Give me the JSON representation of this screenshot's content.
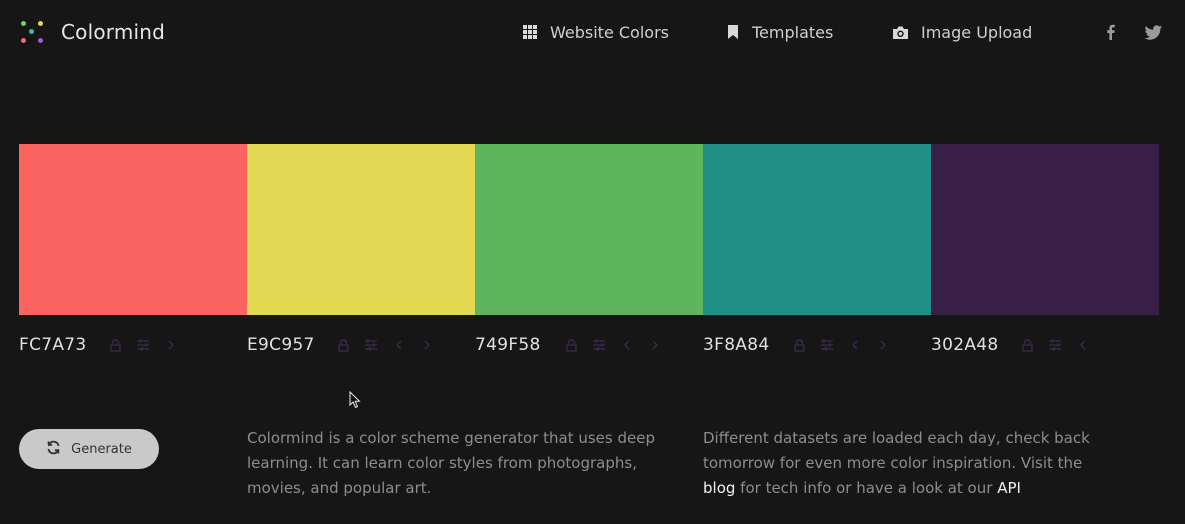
{
  "header": {
    "brand": "Colormind",
    "nav": [
      {
        "label": "Website Colors",
        "icon": "grid-icon"
      },
      {
        "label": "Templates",
        "icon": "bookmark-icon"
      },
      {
        "label": "Image Upload",
        "icon": "camera-icon"
      }
    ],
    "social": [
      {
        "icon": "facebook-icon"
      },
      {
        "icon": "twitter-icon"
      }
    ]
  },
  "palette": {
    "swatches": [
      {
        "hex": "FC7A73",
        "color": "#FC6461"
      },
      {
        "hex": "E9C957",
        "color": "#E3D953"
      },
      {
        "hex": "749F58",
        "color": "#5FB45E"
      },
      {
        "hex": "3F8A84",
        "color": "#208F86"
      },
      {
        "hex": "302A48",
        "color": "#391E48"
      }
    ]
  },
  "controls": {
    "generate_label": "Generate"
  },
  "description": {
    "left": "Colormind is a color scheme generator that uses deep learning. It can learn color styles from photographs, movies, and popular art.",
    "right_prefix": "Different datasets are loaded each day, check back tomorrow for even more color inspiration. Visit the",
    "blog_link": "blog",
    "right_middle": "for tech info or have a look at our",
    "api_link": "API"
  },
  "theme": {
    "background": "#161616",
    "control_icon_color": "#3d2a52"
  }
}
